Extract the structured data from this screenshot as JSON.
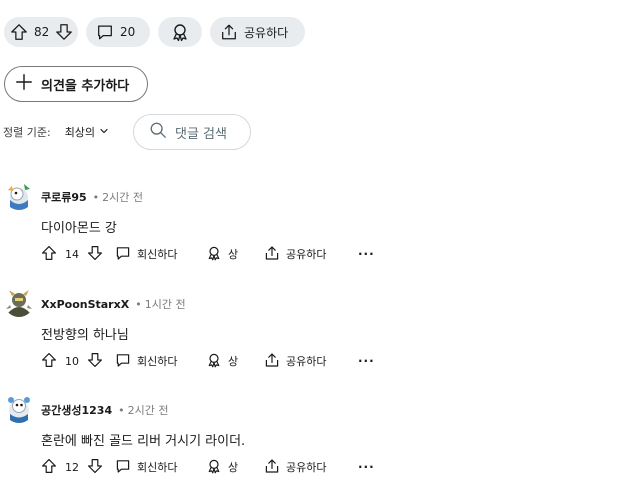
{
  "post_actions": {
    "upvote_count": "82",
    "comment_count": "20",
    "share_label": "공유하다"
  },
  "add_comment_label": "의견을 추가하다",
  "sort": {
    "label": "정렬 기준:",
    "value": "최상의"
  },
  "search": {
    "placeholder": "댓글 검색"
  },
  "comments": [
    {
      "username": "쿠로류95",
      "time": "2시간 전",
      "text": "다이아몬드 강",
      "votes": "14",
      "reply_label": "회신하다",
      "award_label": "상",
      "share_label": "공유하다",
      "more_label": "···"
    },
    {
      "username": "XxPoonStarxX",
      "time": "1시간 전",
      "text": "전방향의 하나님",
      "votes": "10",
      "reply_label": "회신하다",
      "award_label": "상",
      "share_label": "공유하다",
      "more_label": "···"
    },
    {
      "username": "공간생성1234",
      "time": "2시간 전",
      "text": "혼란에 빠진 골드 리버 거시기 라이더.",
      "votes": "12",
      "reply_label": "회신하다",
      "award_label": "상",
      "share_label": "공유하다",
      "more_label": "···"
    }
  ],
  "colors": {
    "pill_bg": "#e9ecef",
    "text": "#1a1a1b",
    "muted": "#7c7c7c",
    "border": "#79797d"
  }
}
